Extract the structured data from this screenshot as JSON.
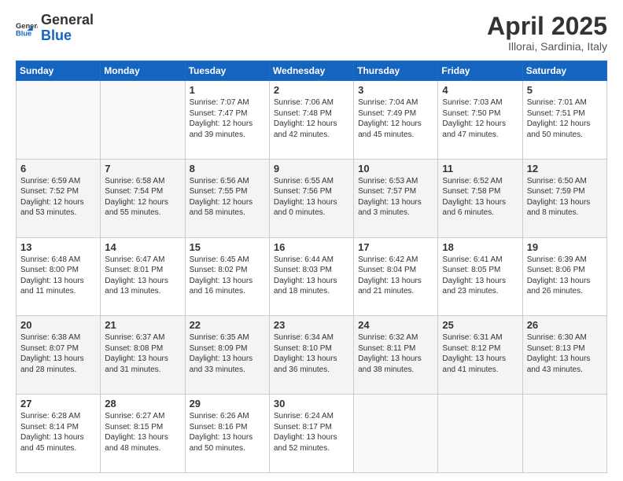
{
  "header": {
    "logo_line1": "General",
    "logo_line2": "Blue",
    "month_title": "April 2025",
    "subtitle": "Illorai, Sardinia, Italy"
  },
  "weekdays": [
    "Sunday",
    "Monday",
    "Tuesday",
    "Wednesday",
    "Thursday",
    "Friday",
    "Saturday"
  ],
  "weeks": [
    [
      {
        "day": "",
        "text": ""
      },
      {
        "day": "",
        "text": ""
      },
      {
        "day": "1",
        "text": "Sunrise: 7:07 AM\nSunset: 7:47 PM\nDaylight: 12 hours and 39 minutes."
      },
      {
        "day": "2",
        "text": "Sunrise: 7:06 AM\nSunset: 7:48 PM\nDaylight: 12 hours and 42 minutes."
      },
      {
        "day": "3",
        "text": "Sunrise: 7:04 AM\nSunset: 7:49 PM\nDaylight: 12 hours and 45 minutes."
      },
      {
        "day": "4",
        "text": "Sunrise: 7:03 AM\nSunset: 7:50 PM\nDaylight: 12 hours and 47 minutes."
      },
      {
        "day": "5",
        "text": "Sunrise: 7:01 AM\nSunset: 7:51 PM\nDaylight: 12 hours and 50 minutes."
      }
    ],
    [
      {
        "day": "6",
        "text": "Sunrise: 6:59 AM\nSunset: 7:52 PM\nDaylight: 12 hours and 53 minutes."
      },
      {
        "day": "7",
        "text": "Sunrise: 6:58 AM\nSunset: 7:54 PM\nDaylight: 12 hours and 55 minutes."
      },
      {
        "day": "8",
        "text": "Sunrise: 6:56 AM\nSunset: 7:55 PM\nDaylight: 12 hours and 58 minutes."
      },
      {
        "day": "9",
        "text": "Sunrise: 6:55 AM\nSunset: 7:56 PM\nDaylight: 13 hours and 0 minutes."
      },
      {
        "day": "10",
        "text": "Sunrise: 6:53 AM\nSunset: 7:57 PM\nDaylight: 13 hours and 3 minutes."
      },
      {
        "day": "11",
        "text": "Sunrise: 6:52 AM\nSunset: 7:58 PM\nDaylight: 13 hours and 6 minutes."
      },
      {
        "day": "12",
        "text": "Sunrise: 6:50 AM\nSunset: 7:59 PM\nDaylight: 13 hours and 8 minutes."
      }
    ],
    [
      {
        "day": "13",
        "text": "Sunrise: 6:48 AM\nSunset: 8:00 PM\nDaylight: 13 hours and 11 minutes."
      },
      {
        "day": "14",
        "text": "Sunrise: 6:47 AM\nSunset: 8:01 PM\nDaylight: 13 hours and 13 minutes."
      },
      {
        "day": "15",
        "text": "Sunrise: 6:45 AM\nSunset: 8:02 PM\nDaylight: 13 hours and 16 minutes."
      },
      {
        "day": "16",
        "text": "Sunrise: 6:44 AM\nSunset: 8:03 PM\nDaylight: 13 hours and 18 minutes."
      },
      {
        "day": "17",
        "text": "Sunrise: 6:42 AM\nSunset: 8:04 PM\nDaylight: 13 hours and 21 minutes."
      },
      {
        "day": "18",
        "text": "Sunrise: 6:41 AM\nSunset: 8:05 PM\nDaylight: 13 hours and 23 minutes."
      },
      {
        "day": "19",
        "text": "Sunrise: 6:39 AM\nSunset: 8:06 PM\nDaylight: 13 hours and 26 minutes."
      }
    ],
    [
      {
        "day": "20",
        "text": "Sunrise: 6:38 AM\nSunset: 8:07 PM\nDaylight: 13 hours and 28 minutes."
      },
      {
        "day": "21",
        "text": "Sunrise: 6:37 AM\nSunset: 8:08 PM\nDaylight: 13 hours and 31 minutes."
      },
      {
        "day": "22",
        "text": "Sunrise: 6:35 AM\nSunset: 8:09 PM\nDaylight: 13 hours and 33 minutes."
      },
      {
        "day": "23",
        "text": "Sunrise: 6:34 AM\nSunset: 8:10 PM\nDaylight: 13 hours and 36 minutes."
      },
      {
        "day": "24",
        "text": "Sunrise: 6:32 AM\nSunset: 8:11 PM\nDaylight: 13 hours and 38 minutes."
      },
      {
        "day": "25",
        "text": "Sunrise: 6:31 AM\nSunset: 8:12 PM\nDaylight: 13 hours and 41 minutes."
      },
      {
        "day": "26",
        "text": "Sunrise: 6:30 AM\nSunset: 8:13 PM\nDaylight: 13 hours and 43 minutes."
      }
    ],
    [
      {
        "day": "27",
        "text": "Sunrise: 6:28 AM\nSunset: 8:14 PM\nDaylight: 13 hours and 45 minutes."
      },
      {
        "day": "28",
        "text": "Sunrise: 6:27 AM\nSunset: 8:15 PM\nDaylight: 13 hours and 48 minutes."
      },
      {
        "day": "29",
        "text": "Sunrise: 6:26 AM\nSunset: 8:16 PM\nDaylight: 13 hours and 50 minutes."
      },
      {
        "day": "30",
        "text": "Sunrise: 6:24 AM\nSunset: 8:17 PM\nDaylight: 13 hours and 52 minutes."
      },
      {
        "day": "",
        "text": ""
      },
      {
        "day": "",
        "text": ""
      },
      {
        "day": "",
        "text": ""
      }
    ]
  ]
}
